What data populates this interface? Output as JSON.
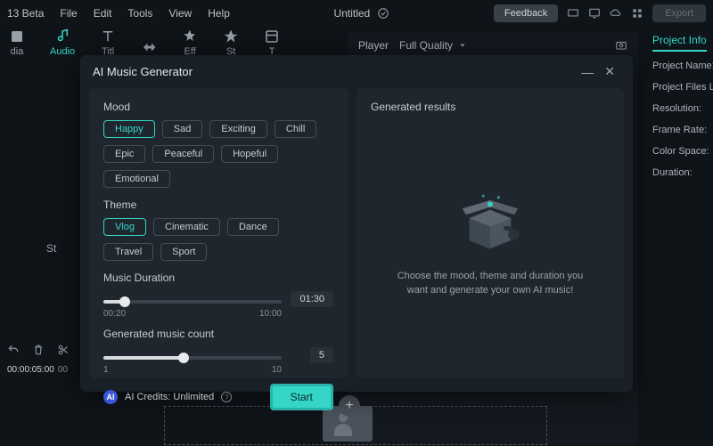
{
  "menubar": {
    "version": "13 Beta",
    "items": [
      "File",
      "Edit",
      "Tools",
      "View",
      "Help"
    ],
    "title": "Untitled",
    "feedback": "Feedback",
    "export": "Export"
  },
  "tabs": {
    "media": "dia",
    "audio": "Audio",
    "titles": "Titl",
    "trans_icon": "",
    "effects": "Eff",
    "stickers": "St",
    "templates": "T"
  },
  "sidebar_label": "St",
  "player": {
    "label": "Player",
    "quality": "Full Quality"
  },
  "info_panel": {
    "title": "Project Info",
    "props": [
      "Project Name:",
      "Project Files Loc",
      "Resolution:",
      "Frame Rate:",
      "Color Space:",
      "Duration:"
    ]
  },
  "modal": {
    "title": "AI Music Generator",
    "mood_label": "Mood",
    "moods": [
      {
        "label": "Happy",
        "active": true
      },
      {
        "label": "Sad",
        "active": false
      },
      {
        "label": "Exciting",
        "active": false
      },
      {
        "label": "Chill",
        "active": false
      },
      {
        "label": "Epic",
        "active": false
      },
      {
        "label": "Peaceful",
        "active": false
      },
      {
        "label": "Hopeful",
        "active": false
      },
      {
        "label": "Emotional",
        "active": false
      }
    ],
    "theme_label": "Theme",
    "themes": [
      {
        "label": "Vlog",
        "active": true
      },
      {
        "label": "Cinematic",
        "active": false
      },
      {
        "label": "Dance",
        "active": false
      },
      {
        "label": "Travel",
        "active": false
      },
      {
        "label": "Sport",
        "active": false
      }
    ],
    "duration_label": "Music Duration",
    "duration_min": "00:20",
    "duration_max": "10:00",
    "duration_value": "01:30",
    "count_label": "Generated music count",
    "count_min": "1",
    "count_max": "10",
    "count_value": "5",
    "credits_label": "AI Credits: Unlimited",
    "start": "Start",
    "gen_title": "Generated results",
    "gen_hint": "Choose the mood, theme and duration you want and generate your own AI music!"
  },
  "timeline": {
    "t1": "00:00:05:00",
    "t2": "00"
  }
}
